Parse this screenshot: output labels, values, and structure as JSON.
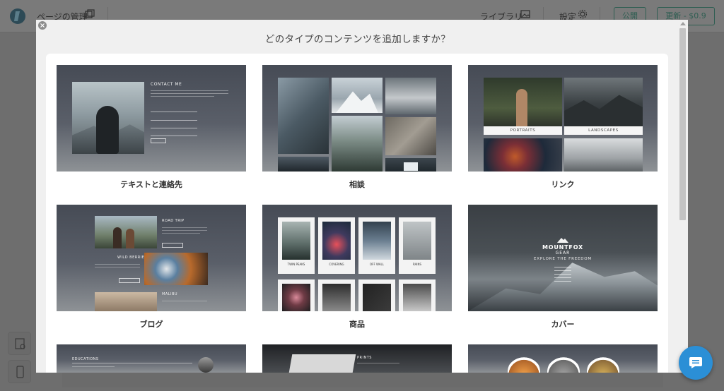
{
  "app": {
    "pages_label": "ページの管理",
    "library_label": "ライブラリ",
    "settings_label": "設定",
    "publish_label": "公開",
    "update_label": "更新 - $0.9"
  },
  "modal": {
    "title": "どのタイプのコンテンツを追加しますか？",
    "cards": [
      {
        "label": "テキストと連絡先",
        "thumb_text": "CONTACT ME"
      },
      {
        "label": "相談"
      },
      {
        "label": "リンク",
        "thumb_text_1": "PORTRAITS",
        "thumb_text_2": "LANDSCAPES"
      },
      {
        "label": "ブログ",
        "thumb_text_1": "ROAD TRIP",
        "thumb_text_2": "WILD BERRIES",
        "thumb_text_3": "MALIBU"
      },
      {
        "label": "商品",
        "thumb_text_1": "TWIN PEAKS",
        "thumb_text_2": "COVERING",
        "thumb_text_3": "OFF WALL",
        "thumb_text_4": "RAINS"
      },
      {
        "label": "カバー",
        "thumb_text_1": "MOUNTFOX",
        "thumb_text_2": "GEAR",
        "thumb_text_3": "EXPLORE THE FREEDOM"
      },
      {
        "label": "",
        "thumb_text": "EDUCATIONS"
      },
      {
        "label": "",
        "thumb_text": "PRINTS"
      },
      {
        "label": ""
      }
    ]
  },
  "icons": {
    "logo": "logo-icon",
    "pages": "pages-icon",
    "library": "image-icon",
    "settings": "gear-icon",
    "close": "close-icon",
    "chat": "chat-icon",
    "side_search": "search-page-icon",
    "side_mobile": "mobile-icon"
  },
  "colors": {
    "overlay": "#6e6e6e",
    "accent": "#2f5e52",
    "chat": "#2b8fd6"
  }
}
